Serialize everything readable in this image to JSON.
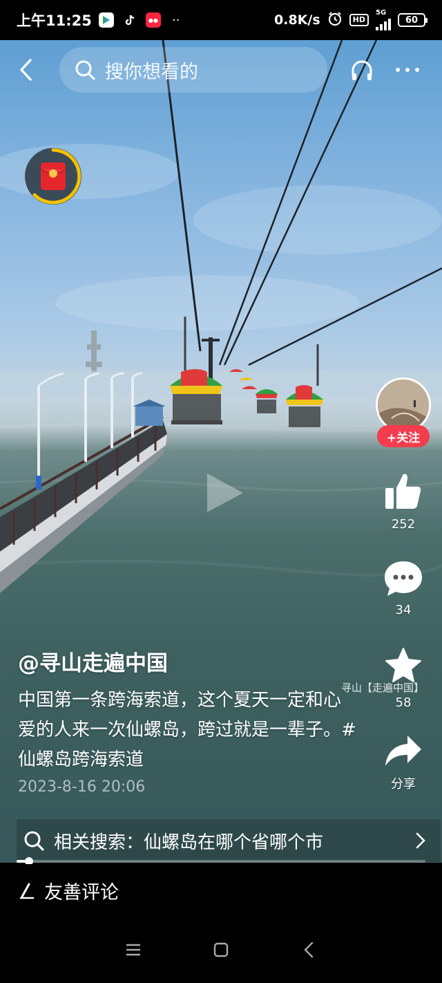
{
  "status_bar": {
    "time": "上午11:25",
    "network_speed": "0.8K/s",
    "hd": "HD",
    "signal_label": "5G",
    "battery": "60",
    "overflow": "··"
  },
  "top_bar": {
    "search_placeholder": "搜你想看的"
  },
  "video": {
    "author": "@寻山走遍中国",
    "description": "中国第一条跨海索道，这个夏天一定和心爱的人来一次仙螺岛，跨过就是一辈子。#仙螺岛跨海索道",
    "date": "2023-8-16 20:06",
    "watermark": "寻山【走遍中国】",
    "progress": 0.03
  },
  "sidebar": {
    "follow_label": "+关注",
    "likes": "252",
    "comments": "34",
    "favorites": "58",
    "share_label": "分享"
  },
  "related_search": {
    "text": "相关搜索：仙螺岛在哪个省哪个市"
  },
  "comment_input": {
    "placeholder": "友善评论"
  },
  "colors": {
    "follow_button": "#f23d4f",
    "redpacket_ring": "#f2c200",
    "sky": "#86b5df",
    "sea": "#3e6160"
  }
}
